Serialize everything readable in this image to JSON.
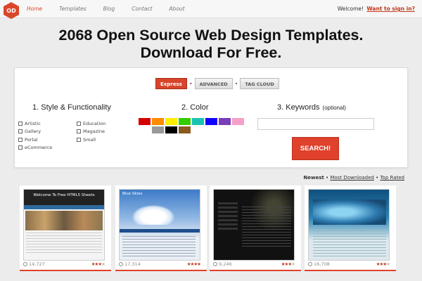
{
  "logo": {
    "text": "OD",
    "color": "#d9472b"
  },
  "nav": {
    "items": [
      "Home",
      "Templates",
      "Blog",
      "Contact",
      "About"
    ],
    "active": "Home"
  },
  "account": {
    "welcome": "Welcome!",
    "signin": "Want to sign in?"
  },
  "headline": {
    "line1": "2068 Open Source Web Design Templates.",
    "line2": "Download For Free."
  },
  "search": {
    "modes": [
      "Express",
      "ADVANCED",
      "TAG CLOUD"
    ],
    "active_mode": "Express",
    "style": {
      "title": "1. Style & Functionality",
      "options_left": [
        "Artistic",
        "Gallery",
        "Portal",
        "eCommerce"
      ],
      "options_right": [
        "Education",
        "Magazine",
        "Small"
      ]
    },
    "color": {
      "title": "2. Color",
      "swatches": [
        "#d40000",
        "#ff8c00",
        "#ffee00",
        "#33cc00",
        "#19c3b3",
        "#1200ff",
        "#7a3db8",
        "#f5a0c8",
        "#ffffff",
        "#999999",
        "#000000",
        "#8b5a1e"
      ]
    },
    "keywords": {
      "title": "3. Keywords",
      "optional": "(optional)",
      "value": "",
      "placeholder": ""
    },
    "button": "SEARCH!"
  },
  "sort": {
    "newest": "Newest",
    "most_downloaded": "Most Downloaded",
    "top_rated": "Top Rated",
    "separator": "•"
  },
  "templates": [
    {
      "views": "14,727",
      "rating": 3,
      "header": "Welcome To Free HTML5 Sheets"
    },
    {
      "views": "17,314",
      "rating": 4,
      "header": "Blue Skies"
    },
    {
      "views": "9,246",
      "rating": 3,
      "header": ""
    },
    {
      "views": "16,708",
      "rating": 3,
      "header": ""
    }
  ]
}
